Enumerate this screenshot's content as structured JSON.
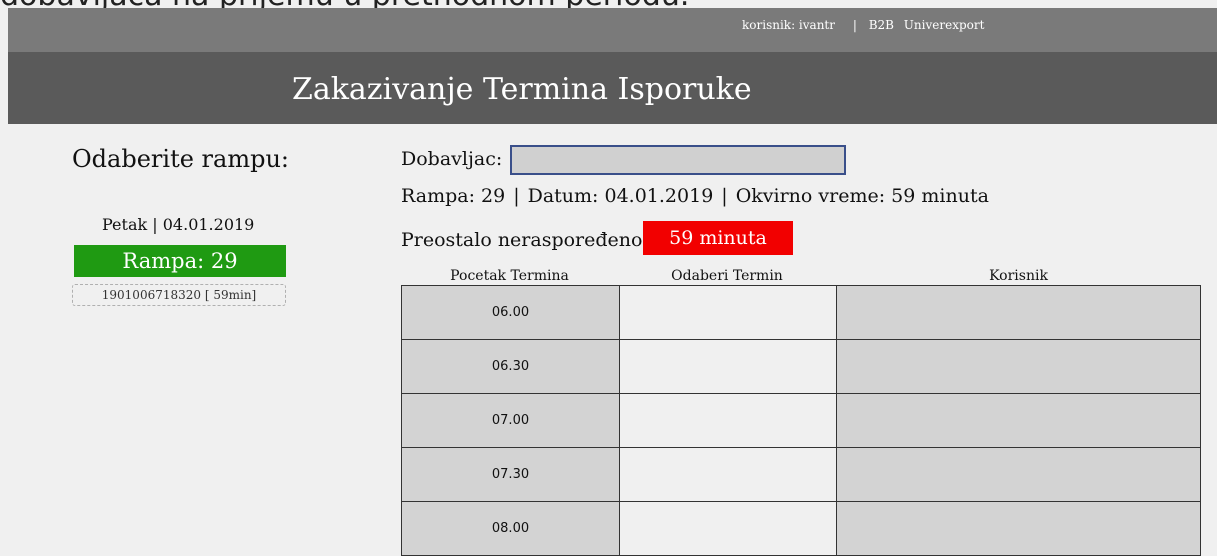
{
  "cut_text": "dobavljača na prijemu u prethodnom periodu.",
  "topbar": {
    "user": "korisnik: ivantr",
    "sep": "|",
    "b2b": "B2B",
    "company": "Univerexport"
  },
  "header": {
    "title": "Zakazivanje Termina Isporuke"
  },
  "left": {
    "heading": "Odaberite rampu:",
    "day_label": "Petak | 04.01.2019",
    "rampa_label": "Rampa: 29",
    "order_chip": "1901006718320 [ 59min]"
  },
  "form": {
    "dobavljac_label": "Dobavljac:",
    "dobavljac_value": "",
    "rampa": "Rampa: 29",
    "datum": "Datum: 04.01.2019",
    "okvirno": "Okvirno vreme: 59 minuta",
    "preostalo_label": "Preostalo neraspoređeno:",
    "preostalo_value": "59 minuta"
  },
  "table": {
    "headers": [
      "Pocetak Termina",
      "Odaberi Termin",
      "Korisnik"
    ],
    "rows": [
      {
        "time": "06.00",
        "user": ""
      },
      {
        "time": "06.30",
        "user": ""
      },
      {
        "time": "07.00",
        "user": ""
      },
      {
        "time": "07.30",
        "user": ""
      },
      {
        "time": "08.00",
        "user": ""
      }
    ]
  },
  "colors": {
    "green": "#1f9a12",
    "red": "#f20000",
    "header_bg": "#5a5a5a",
    "topbar_bg": "#7a7a7a"
  }
}
